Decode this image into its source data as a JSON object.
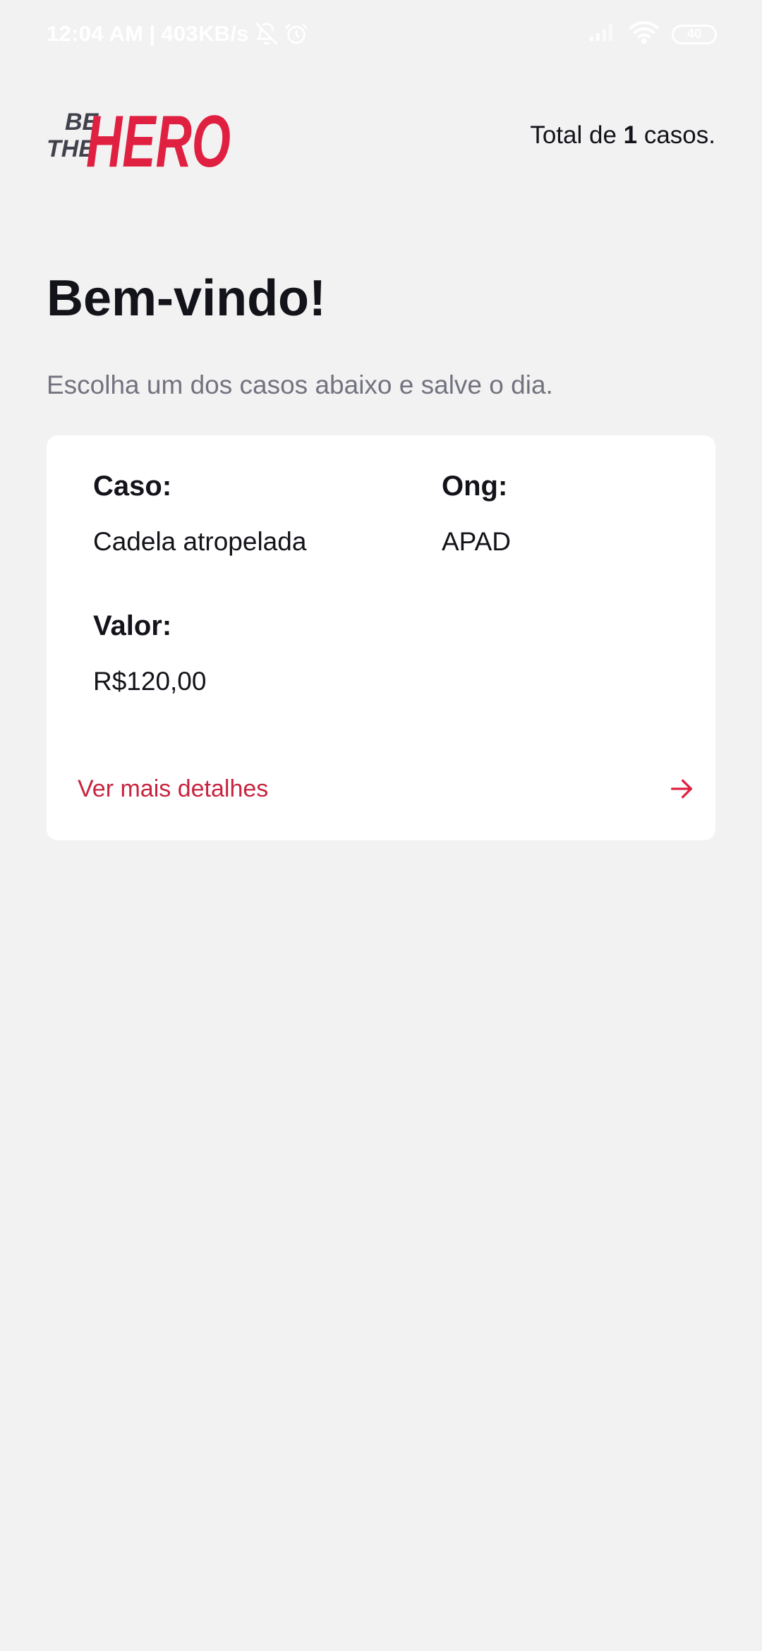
{
  "status_bar": {
    "time": "12:04 AM",
    "separator": "|",
    "speed": "403KB/s",
    "icons": [
      "notifications-off-icon",
      "alarm-icon",
      "signal-icon",
      "wifi-icon",
      "battery-icon"
    ],
    "battery_level": "40"
  },
  "header": {
    "logo_text_small_top": "BE",
    "logo_text_small_bottom": "THE",
    "logo_text_big": "HERO",
    "total_prefix": "Total de ",
    "total_count": "1",
    "total_suffix": " casos."
  },
  "title": "Bem-vindo!",
  "description": "Escolha um dos casos abaixo e salve o dia.",
  "incidents": [
    {
      "case_label": "Caso:",
      "case_value": "Cadela atropelada",
      "ong_label": "Ong:",
      "ong_value": "APAD",
      "valor_label": "Valor:",
      "valor_value": "R$120,00",
      "details_label": "Ver mais detalhes",
      "details_icon": "arrow-right-icon"
    }
  ],
  "colors": {
    "background": "#f2f2f2",
    "brand_red": "#e02041",
    "text_dark": "#13131a",
    "text_muted": "#737380",
    "card": "#ffffff"
  }
}
